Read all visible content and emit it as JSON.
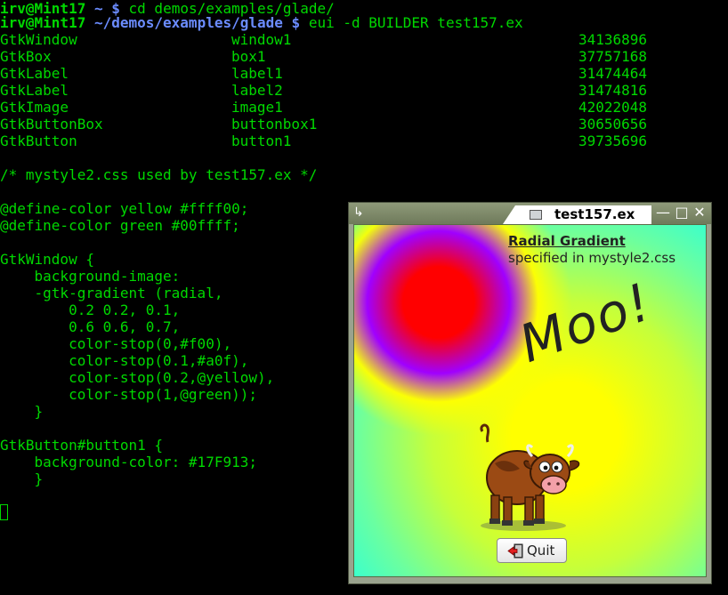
{
  "terminal": {
    "prompt1": {
      "userhost": "irv@Mint17",
      "path": "~",
      "symbol": "$",
      "command": "cd demos/examples/glade/"
    },
    "prompt2": {
      "userhost": "irv@Mint17",
      "path": "~/demos/examples/glade",
      "symbol": "$",
      "command": "eui -d BUILDER test157.ex"
    },
    "object_rows": [
      {
        "type": "GtkWindow",
        "name": "window1",
        "id": "34136896"
      },
      {
        "type": "GtkBox",
        "name": "box1",
        "id": "37757168"
      },
      {
        "type": "GtkLabel",
        "name": "label1",
        "id": "31474464"
      },
      {
        "type": "GtkLabel",
        "name": "label2",
        "id": "31474816"
      },
      {
        "type": "GtkImage",
        "name": "image1",
        "id": "42022048"
      },
      {
        "type": "GtkButtonBox",
        "name": "buttonbox1",
        "id": "30650656"
      },
      {
        "type": "GtkButton",
        "name": "button1",
        "id": "39735696"
      }
    ],
    "css_lines": [
      "/* mystyle2.css used by test157.ex */",
      "",
      "@define-color yellow #ffff00;",
      "@define-color green #00ffff;",
      "",
      "GtkWindow {",
      "    background-image:",
      "    -gtk-gradient (radial,",
      "        0.2 0.2, 0.1,",
      "        0.6 0.6, 0.7,",
      "        color-stop(0,#f00),",
      "        color-stop(0.1,#a0f),",
      "        color-stop(0.2,@yellow),",
      "        color-stop(1,@green));",
      "    }",
      "",
      "GtkButton#button1 {",
      "    background-color: #17F913;",
      "    }"
    ]
  },
  "window": {
    "title": "test157.ex",
    "menu_icon": "window-menu-icon",
    "controls": {
      "minimize": "—",
      "maximize": "□",
      "close": "✕"
    },
    "heading": "Radial Gradient",
    "subtext": "specified in mystyle2.css",
    "moo_text": "Moo!",
    "quit_label": "Quit"
  },
  "colors": {
    "terminal_text": "#00d800",
    "terminal_path": "#6b8cff",
    "terminal_bg": "#000000",
    "gradient_red": "#ff0000",
    "gradient_purple": "#aa00ff",
    "gradient_yellow": "#ffff00",
    "gradient_cyan": "#00ffff"
  }
}
